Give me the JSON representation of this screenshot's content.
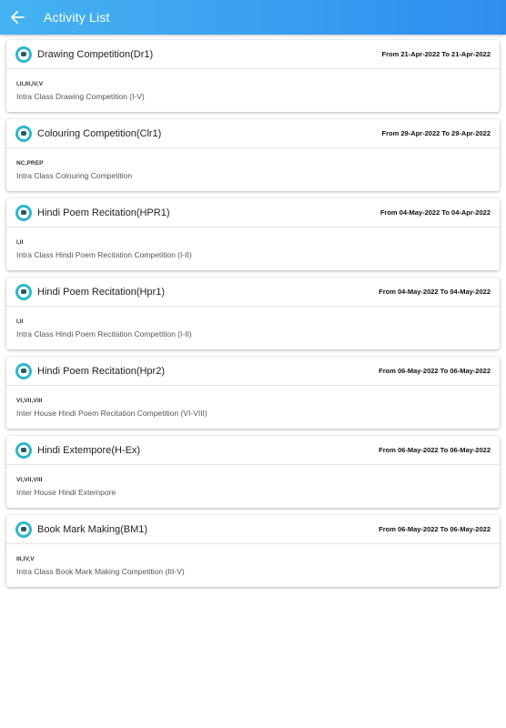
{
  "header": {
    "title": "Activity List",
    "back_icon": "arrow-left-icon"
  },
  "activities": [
    {
      "name": "Drawing Competition(Dr1)",
      "dates": "From 21-Apr-2022 To 21-Apr-2022",
      "classes": "I,II,III,IV,V",
      "description": "Intra Class Drawing Competition (I-V)"
    },
    {
      "name": "Colouring Competition(Clr1)",
      "dates": "From 29-Apr-2022 To 29-Apr-2022",
      "classes": "NC,PREP",
      "description": "Intra Class Colouring Competition"
    },
    {
      "name": "Hindi Poem Recitation(HPR1)",
      "dates": "From 04-May-2022 To 04-Apr-2022",
      "classes": "I,II",
      "description": "Intra Class Hindi Poem Recitation Competition (I-II)"
    },
    {
      "name": "Hindi Poem Recitation(Hpr1)",
      "dates": "From 04-May-2022 To 04-May-2022",
      "classes": "I,II",
      "description": "Intra Class Hindi Poem Recitation Competition (I-II)"
    },
    {
      "name": "Hindi Poem Recitation(Hpr2)",
      "dates": "From 06-May-2022 To 06-May-2022",
      "classes": "VI,VII,VIII",
      "description": "Inter House Hindi Poem Recitation Competition (VI-VIII)"
    },
    {
      "name": "Hindi Extempore(H-Ex)",
      "dates": "From 06-May-2022 To 06-May-2022",
      "classes": "VI,VII,VIII",
      "description": "Inter House Hindi Extempore"
    },
    {
      "name": "Book Mark Making(BM1)",
      "dates": "From 06-May-2022 To 06-May-2022",
      "classes": "III,IV,V",
      "description": "Intra Class Book Mark Making Competition (III-V)"
    }
  ],
  "colors": {
    "appbar_start": "#45b3f1",
    "appbar_end": "#2f8df0",
    "activity_icon": "#2fb8c9"
  }
}
